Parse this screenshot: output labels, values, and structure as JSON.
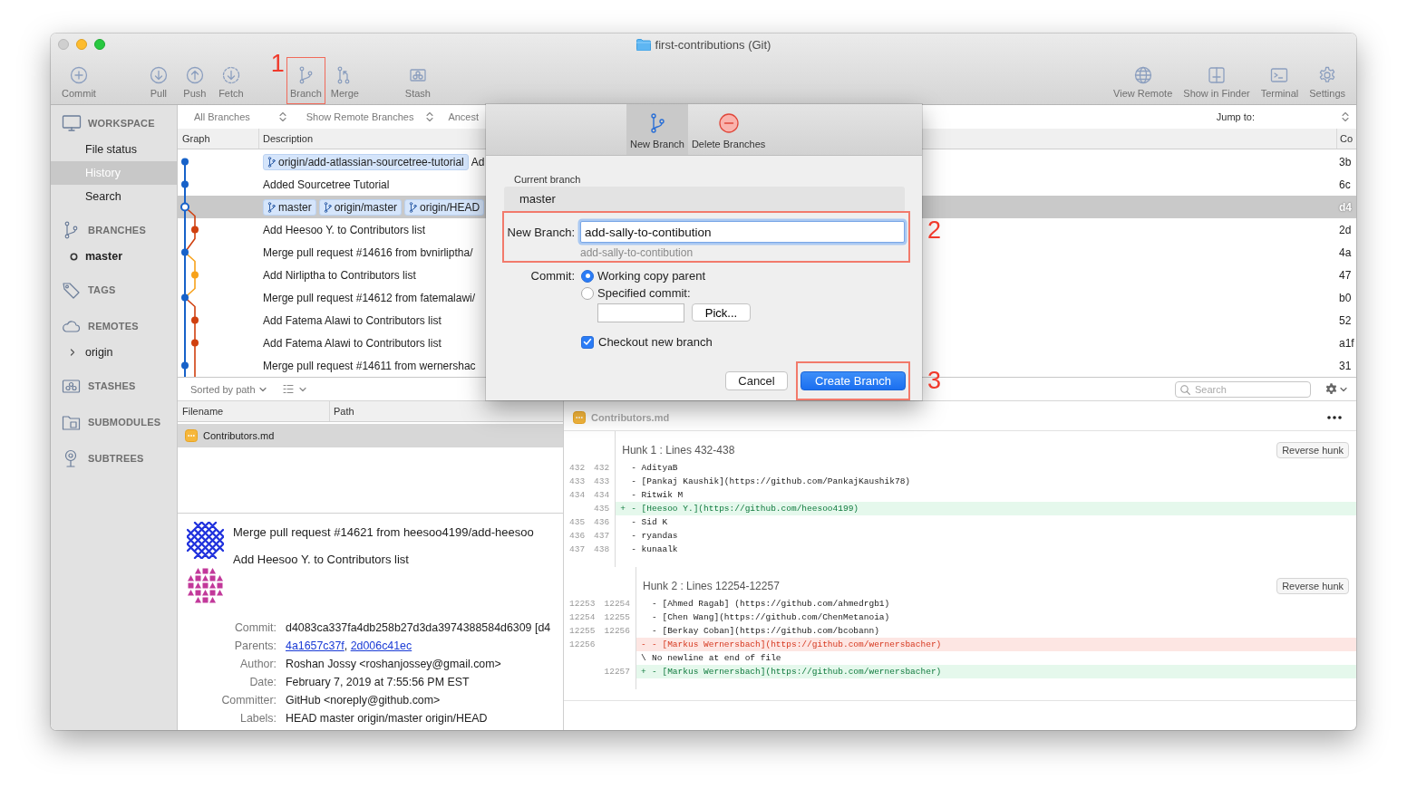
{
  "window": {
    "title": "first-contributions (Git)"
  },
  "toolbar": {
    "groups": [
      {
        "items": [
          {
            "label": "Commit",
            "kind": "plus"
          }
        ]
      },
      {
        "items": [
          {
            "label": "Pull",
            "kind": "down"
          },
          {
            "label": "Push",
            "kind": "up"
          },
          {
            "label": "Fetch",
            "kind": "fetch"
          }
        ]
      },
      {
        "items": [
          {
            "label": "Branch",
            "kind": "branch",
            "annotation": "1"
          },
          {
            "label": "Merge",
            "kind": "merge"
          }
        ]
      },
      {
        "items": [
          {
            "label": "Stash",
            "kind": "stash"
          }
        ]
      }
    ],
    "right": [
      {
        "label": "View Remote",
        "kind": "globe"
      },
      {
        "label": "Show in Finder",
        "kind": "finder"
      },
      {
        "label": "Terminal",
        "kind": "terminal"
      },
      {
        "label": "Settings",
        "kind": "gear"
      }
    ]
  },
  "sidebar": {
    "sections": [
      {
        "label": "WORKSPACE",
        "kind": "monitor",
        "items": [
          {
            "label": "File status",
            "selected": false
          },
          {
            "label": "History",
            "selected": true
          },
          {
            "label": "Search",
            "selected": false
          }
        ]
      },
      {
        "label": "BRANCHES",
        "kind": "branch",
        "items": [
          {
            "label": "master",
            "current": true
          }
        ]
      },
      {
        "label": "TAGS",
        "kind": "tag"
      },
      {
        "label": "REMOTES",
        "kind": "cloud",
        "items": [
          {
            "label": "origin",
            "expanded": false
          }
        ]
      },
      {
        "label": "STASHES",
        "kind": "stash"
      },
      {
        "label": "SUBMODULES",
        "kind": "folder"
      },
      {
        "label": "SUBTREES",
        "kind": "tree"
      }
    ]
  },
  "commit_list": {
    "filters": [
      "All Branches",
      "Show Remote Branches",
      "Ancest"
    ],
    "jump_label": "Jump to:",
    "columns": [
      "Graph",
      "Description",
      "Co"
    ],
    "rows": [
      {
        "tags": [
          "origin/add-atlassian-sourcetree-tutorial"
        ],
        "description": "Ad",
        "column_3": "3b",
        "selected": false
      },
      {
        "description": "Added Sourcetree Tutorial",
        "column_3": "6c",
        "selected": false
      },
      {
        "tags": [
          "master",
          "origin/master",
          "origin/HEAD"
        ],
        "column_3": "d4",
        "selected": true
      },
      {
        "description": "Add Heesoo Y. to Contributors list",
        "column_3": "2d",
        "selected": false
      },
      {
        "description": "Merge pull request #14616 from bvnirliptha/",
        "column_3": "4a",
        "selected": false
      },
      {
        "description": "Add Nirliptha to Contributors list",
        "column_3": "47",
        "selected": false
      },
      {
        "description": "Merge pull request #14612 from fatemalawi/",
        "column_3": "b0",
        "selected": false
      },
      {
        "description": "Add Fatema Alawi to Contributors list",
        "column_3": "52",
        "selected": false
      },
      {
        "description": "Add Fatema Alawi to Contributors list",
        "column_3": "a1f",
        "selected": false
      },
      {
        "description": "Merge pull request #14611 from wernershac",
        "column_3": "31",
        "selected": false
      }
    ]
  },
  "dialog": {
    "tabs": [
      {
        "label": "New Branch",
        "kind": "branch",
        "selected": true
      },
      {
        "label": "Delete Branches",
        "kind": "delete",
        "selected": false
      }
    ],
    "current_branch_label": "Current branch",
    "current_branch": "master",
    "new_branch": {
      "label": "New Branch:",
      "value": "add-sally-to-contibution",
      "hint": "add-sally-to-contibution",
      "annotation": "2"
    },
    "commit_label": "Commit:",
    "commit_options": [
      {
        "label": "Working copy parent",
        "selected": true
      },
      {
        "label": "Specified commit:",
        "selected": false
      }
    ],
    "pick_button": "Pick...",
    "checkout": {
      "label": "Checkout new branch",
      "checked": true
    },
    "buttons": [
      {
        "label": "Cancel",
        "kind": "secondary"
      },
      {
        "label": "Create Branch",
        "kind": "primary",
        "annotation": "3"
      }
    ]
  },
  "file_list": {
    "sort_label": "Sorted by path",
    "columns": [
      "Filename",
      "Path"
    ],
    "files": [
      {
        "name": "Contributors.md",
        "selected": true
      }
    ]
  },
  "commit_details": {
    "summary": "Merge pull request #14621 from heesoo4199/add-heesoo",
    "body": "Add Heesoo Y. to Contributors list",
    "fields": [
      {
        "label": "Commit:",
        "value": "d4083ca337fa4db258b27d3da3974388584d6309 [d4"
      },
      {
        "label": "Parents:",
        "links": [
          "4a1657c37f",
          "2d006c41ec"
        ],
        "separator": ", "
      },
      {
        "label": "Author:",
        "value": "Roshan Jossy <roshanjossey@gmail.com>"
      },
      {
        "label": "Date:",
        "value": "February 7, 2019 at 7:55:56 PM EST"
      },
      {
        "label": "Committer:",
        "value": "GitHub <noreply@github.com>"
      },
      {
        "label": "Labels:",
        "value": "HEAD master origin/master origin/HEAD"
      }
    ]
  },
  "diff": {
    "search_placeholder": "Search",
    "file": "Contributors.md",
    "hunks": [
      {
        "title": "Hunk 1 : Lines 432-438",
        "button": "Reverse hunk",
        "lines": [
          {
            "old": "432",
            "new": "432",
            "kind": "context",
            "text": "- AdityaB"
          },
          {
            "old": "433",
            "new": "433",
            "kind": "context",
            "text": "- [Pankaj Kaushik](https://github.com/PankajKaushik78)"
          },
          {
            "old": "434",
            "new": "434",
            "kind": "context",
            "text": "- Ritwik M"
          },
          {
            "new": "435",
            "kind": "added",
            "sign": "+",
            "text": "- [Heesoo Y.](https://github.com/heesoo4199)"
          },
          {
            "old": "435",
            "new": "436",
            "kind": "context",
            "text": "- Sid K"
          },
          {
            "old": "436",
            "new": "437",
            "kind": "context",
            "text": "- ryandas"
          },
          {
            "old": "437",
            "new": "438",
            "kind": "context",
            "text": "- kunaalk"
          }
        ]
      },
      {
        "title": "Hunk 2 : Lines 12254-12257",
        "button": "Reverse hunk",
        "lines": [
          {
            "old": "12253",
            "new": "12254",
            "kind": "context",
            "text": "- [Ahmed Ragab] (https://github.com/ahmedrgb1)"
          },
          {
            "old": "12254",
            "new": "12255",
            "kind": "context",
            "text": "- [Chen Wang](https://github.com/ChenMetanoia)"
          },
          {
            "old": "12255",
            "new": "12256",
            "kind": "context",
            "text": "- [Berkay Coban](https://github.com/bcobann)"
          },
          {
            "old": "12256",
            "kind": "removed",
            "sign": "-",
            "text": "- [Markus Wernersbach](https://github.com/wernersbacher)"
          },
          {
            "kind": "note",
            "sign": "\\",
            "text": "No newline at end of file"
          },
          {
            "new": "12257",
            "kind": "added",
            "sign": "+",
            "text": "- [Markus Wernersbach](https://github.com/wernersbacher)"
          }
        ]
      }
    ]
  }
}
